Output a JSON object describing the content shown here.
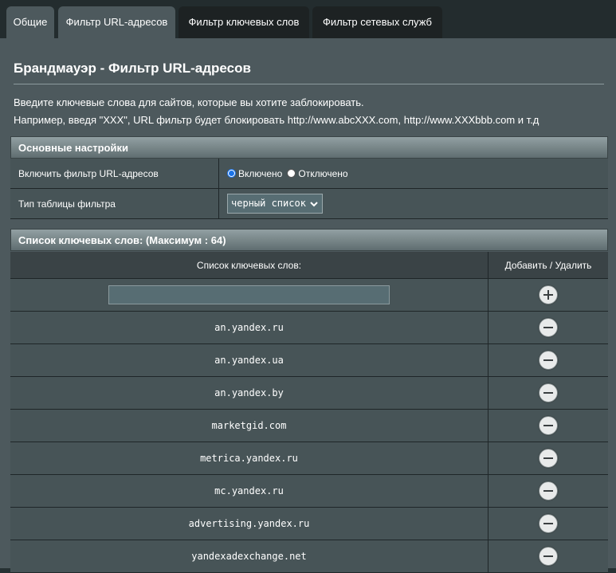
{
  "tabs": [
    {
      "label": "Общие"
    },
    {
      "label": "Фильтр URL-адресов"
    },
    {
      "label": "Фильтр ключевых слов"
    },
    {
      "label": "Фильтр сетевых служб"
    }
  ],
  "page": {
    "title": "Брандмауэр - Фильтр URL-адресов",
    "description_line1": "Введите ключевые слова для сайтов, которые вы хотите заблокировать.",
    "description_line2": "Например, введя \"XXX\", URL фильтр будет блокировать http://www.abcXXX.com, http://www.XXXbbb.com и т.д"
  },
  "basic_settings": {
    "header": "Основные настройки",
    "enable_label": "Включить фильтр URL-адресов",
    "enable_on": "Включено",
    "enable_off": "Отключено",
    "enabled": true,
    "table_type_label": "Тип таблицы фильтра",
    "table_type_value": "черный список"
  },
  "keyword_list": {
    "header": "Список ключевых слов: (Максимум : 64)",
    "col_keywords": "Список ключевых слов:",
    "col_actions": "Добавить / Удалить",
    "new_keyword_value": "",
    "add_icon": "plus-circle-icon",
    "remove_icon": "minus-circle-icon",
    "items": [
      "an.yandex.ru",
      "an.yandex.ua",
      "an.yandex.by",
      "marketgid.com",
      "metrica.yandex.ru",
      "mc.yandex.ru",
      "advertising.yandex.ru",
      "yandexadexchange.net"
    ]
  }
}
